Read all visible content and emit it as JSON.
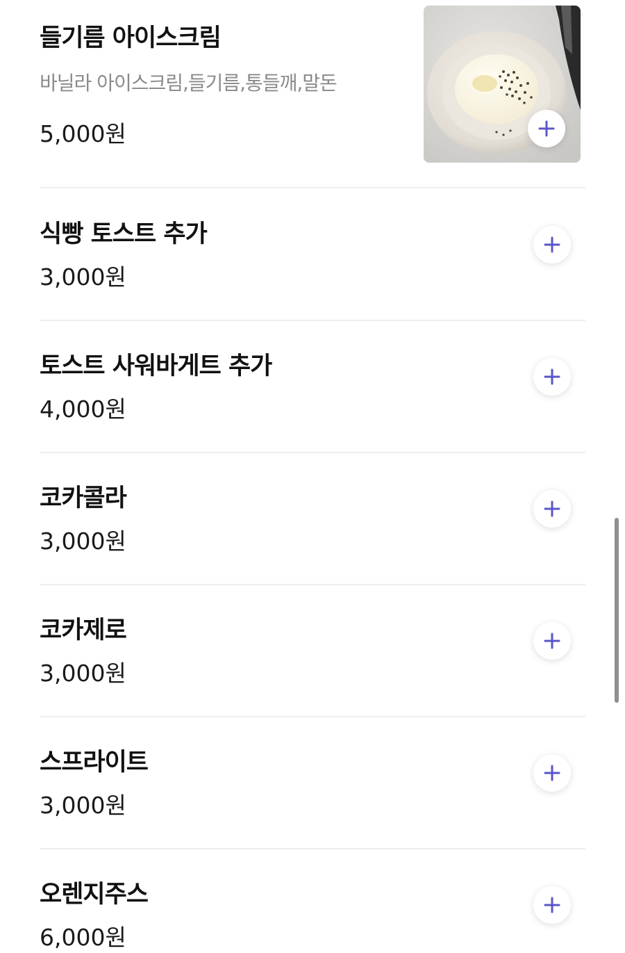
{
  "menu": {
    "items": [
      {
        "name": "들기름 아이스크림",
        "description": "바닐라 아이스크림,들기름,통들깨,말돈",
        "price": "5,000원",
        "add_icon": "plus-icon"
      },
      {
        "name": "식빵 토스트 추가",
        "price": "3,000원",
        "add_icon": "plus-icon"
      },
      {
        "name": "토스트 사워바게트 추가",
        "price": "4,000원",
        "add_icon": "plus-icon"
      },
      {
        "name": "코카콜라",
        "price": "3,000원",
        "add_icon": "plus-icon"
      },
      {
        "name": "코카제로",
        "price": "3,000원",
        "add_icon": "plus-icon"
      },
      {
        "name": "스프라이트",
        "price": "3,000원",
        "add_icon": "plus-icon"
      },
      {
        "name": "오렌지주스",
        "price": "6,000원",
        "add_icon": "plus-icon"
      }
    ]
  },
  "colors": {
    "accent": "#5b55c9",
    "name_text": "#111111",
    "description_text": "#8a8a8a",
    "divider": "#eeeeee"
  }
}
